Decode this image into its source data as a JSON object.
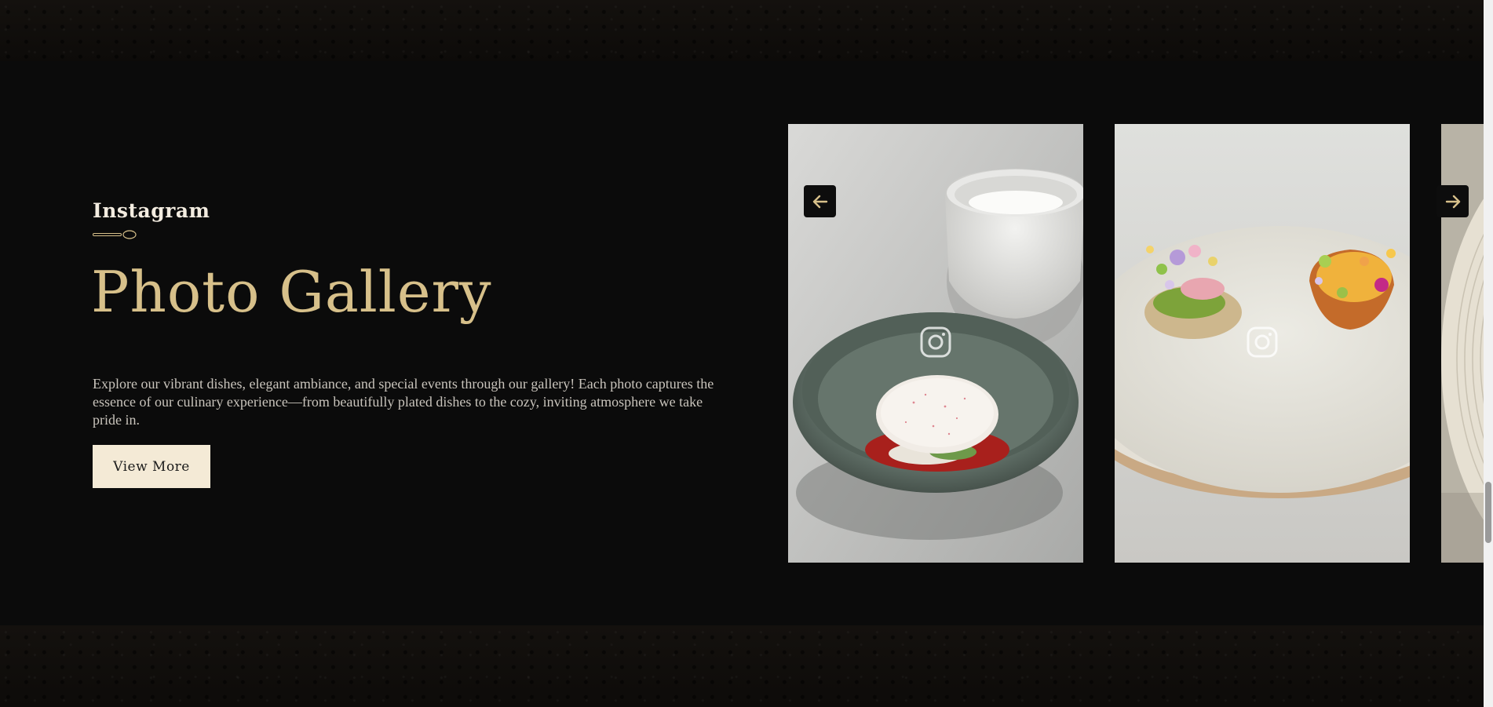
{
  "section": {
    "eyebrow": "Instagram",
    "title": "Photo Gallery",
    "description": "Explore our vibrant dishes, elegant ambiance, and special events through our gallery! Each photo captures the essence of our culinary experience—from beautifully plated dishes to the cozy, inviting atmosphere we take pride in.",
    "button_label": "View More"
  },
  "gallery": {
    "photos": [
      {
        "subject": "dessert bowl with white disc and red berries beside marble bowl",
        "overlay_icon": "instagram-icon"
      },
      {
        "subject": "two plated canapés with edible flowers on cream plate",
        "overlay_icon": "instagram-icon"
      },
      {
        "subject": "partially visible ceramic plate",
        "overlay_icon": "none"
      }
    ],
    "prev_icon": "arrow-left-icon",
    "next_icon": "arrow-right-icon"
  },
  "colors": {
    "background": "#0b0b0b",
    "accent_gold": "#d7c08a",
    "button_bg": "#f4ead6",
    "text_light": "#f3ece0",
    "text_body": "#c9c4bc"
  }
}
